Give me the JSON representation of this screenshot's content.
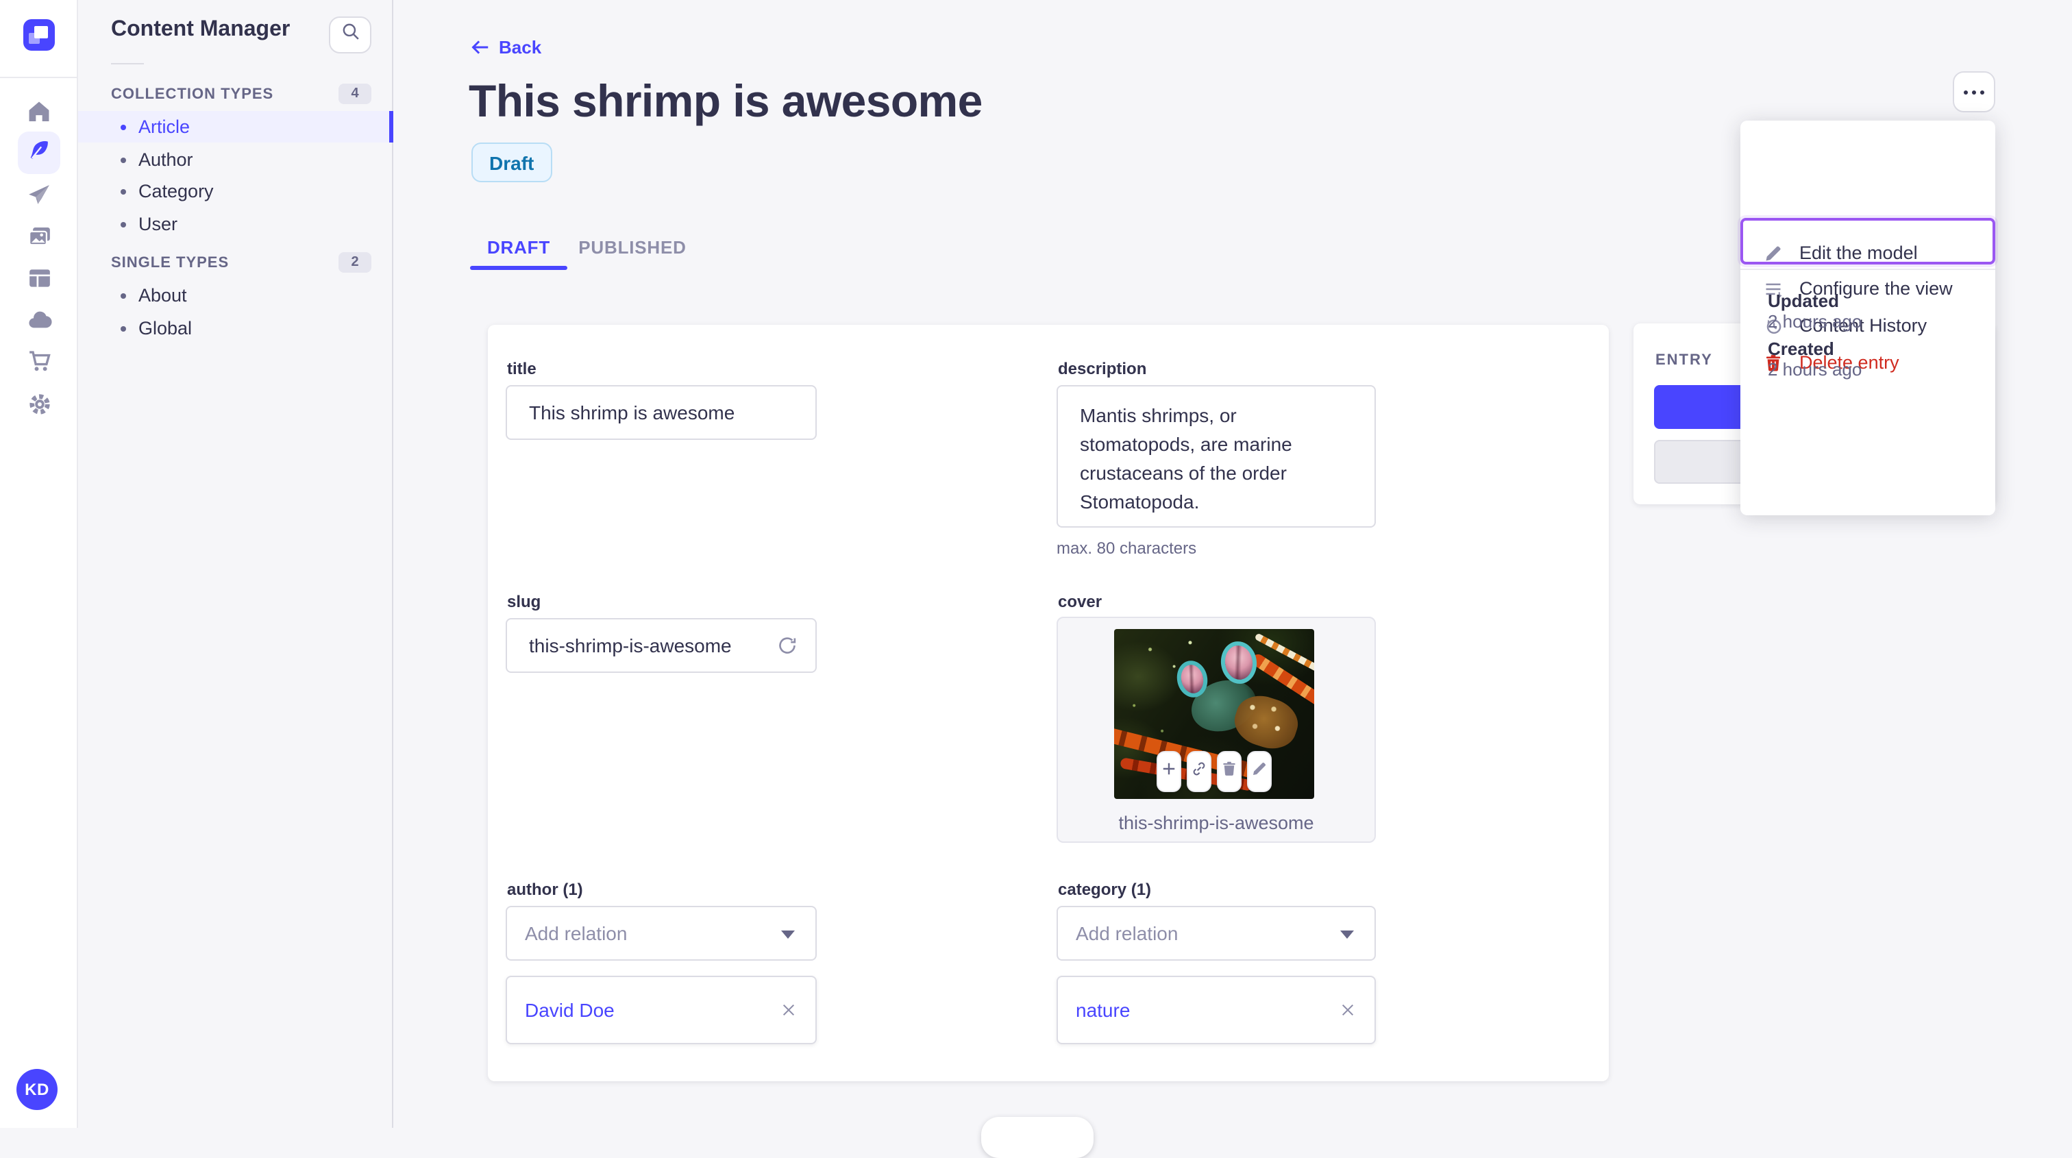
{
  "subnav": {
    "title": "Content Manager",
    "sections": [
      {
        "label": "COLLECTION TYPES",
        "count": "4",
        "items": [
          {
            "label": "Article",
            "active": true
          },
          {
            "label": "Author",
            "active": false
          },
          {
            "label": "Category",
            "active": false
          },
          {
            "label": "User",
            "active": false
          }
        ]
      },
      {
        "label": "SINGLE TYPES",
        "count": "2",
        "items": [
          {
            "label": "About",
            "active": false
          },
          {
            "label": "Global",
            "active": false
          }
        ]
      }
    ]
  },
  "header": {
    "back_label": "Back",
    "title": "This shrimp is awesome",
    "status_badge": "Draft",
    "tabs": [
      {
        "label": "DRAFT",
        "active": true
      },
      {
        "label": "PUBLISHED",
        "active": false
      }
    ]
  },
  "form": {
    "title": {
      "label": "title",
      "value": "This shrimp is awesome"
    },
    "description": {
      "label": "description",
      "value": "Mantis shrimps, or stomatopods, are marine crustaceans of the order Stomatopoda.",
      "hint": "max. 80 characters"
    },
    "slug": {
      "label": "slug",
      "value": "this-shrimp-is-awesome"
    },
    "cover": {
      "label": "cover",
      "caption": "this-shrimp-is-awesome"
    },
    "author": {
      "label": "author (1)",
      "placeholder": "Add relation",
      "relation": "David Doe"
    },
    "category": {
      "label": "category (1)",
      "placeholder": "Add relation",
      "relation": "nature"
    }
  },
  "entry_panel": {
    "heading": "ENTRY"
  },
  "menu": {
    "items": [
      {
        "label": "Edit the model",
        "icon": "pencil-icon",
        "danger": false
      },
      {
        "label": "Configure the view",
        "icon": "configure-icon",
        "danger": false
      },
      {
        "label": "Content History",
        "icon": "history-clock-icon",
        "danger": false
      },
      {
        "label": "Delete entry",
        "icon": "trash-icon",
        "danger": true,
        "highlighted": true
      }
    ],
    "meta": [
      {
        "label": "Updated",
        "value": "2 hours ago"
      },
      {
        "label": "Created",
        "value": "2 hours ago"
      }
    ]
  },
  "icon_sidebar": [
    "home-icon",
    "content-manager-feather-icon",
    "releases-send-icon",
    "media-library-icon",
    "layout-icon",
    "deploy-cloud-icon",
    "marketplace-cart-icon",
    "settings-gear-icon"
  ],
  "avatar": {
    "initials": "KD"
  },
  "colors": {
    "accent": "#4945ff",
    "danger": "#d02b20",
    "highlight_outline": "#9b57f2",
    "draft_badge_bg": "#eaf5ff",
    "draft_badge_text": "#1074ad",
    "page_bg": "#f6f6f9",
    "text_dark": "#32324d",
    "text_gray": "#666687"
  }
}
